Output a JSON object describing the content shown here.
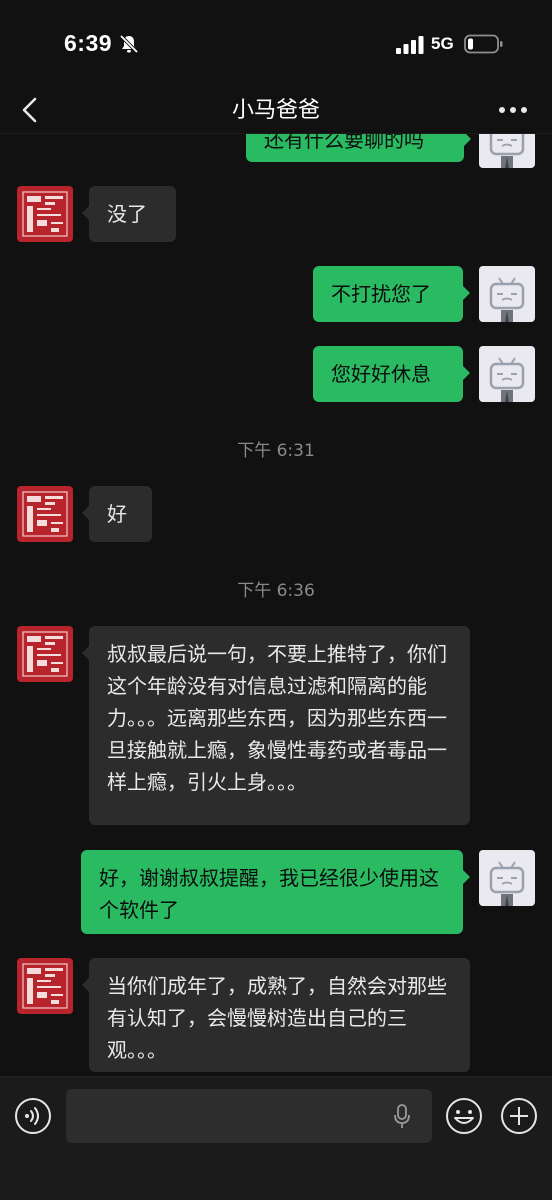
{
  "status_bar": {
    "time": "6:39",
    "network": "5G"
  },
  "nav": {
    "title": "小马爸爸"
  },
  "messages": [
    {
      "side": "right",
      "text": "还有什么要聊的吗",
      "partial": true
    },
    {
      "side": "left",
      "text": "没了"
    },
    {
      "side": "right",
      "text": "不打扰您了"
    },
    {
      "side": "right",
      "text": "您好好休息"
    },
    {
      "type": "time",
      "text": "下午 6:31"
    },
    {
      "side": "left",
      "text": "好"
    },
    {
      "type": "time",
      "text": "下午 6:36"
    },
    {
      "side": "left",
      "text": "叔叔最后说一句，不要上推特了，你们这个年龄没有对信息过滤和隔离的能力。。。远离那些东西，因为那些东西一旦接触就上瘾，象慢性毒药或者毒品一样上瘾，引火上身。。。"
    },
    {
      "side": "right",
      "text": "好，谢谢叔叔提醒，我已经很少使用这个软件了"
    },
    {
      "side": "left",
      "text": "当你们成年了，成熟了，自然会对那些有认知了，会慢慢树造出自己的三观。。。"
    }
  ],
  "input": {
    "placeholder": ""
  },
  "colors": {
    "background": "#111111",
    "bubble_self": "#29ba62",
    "bubble_other": "#2c2c2c",
    "avatar_other": "#b8242b"
  },
  "icons": [
    "mute-icon",
    "signal-icon",
    "battery-icon",
    "back-icon",
    "more-icon",
    "voice-icon",
    "mic-icon",
    "emoji-icon",
    "plus-icon"
  ]
}
